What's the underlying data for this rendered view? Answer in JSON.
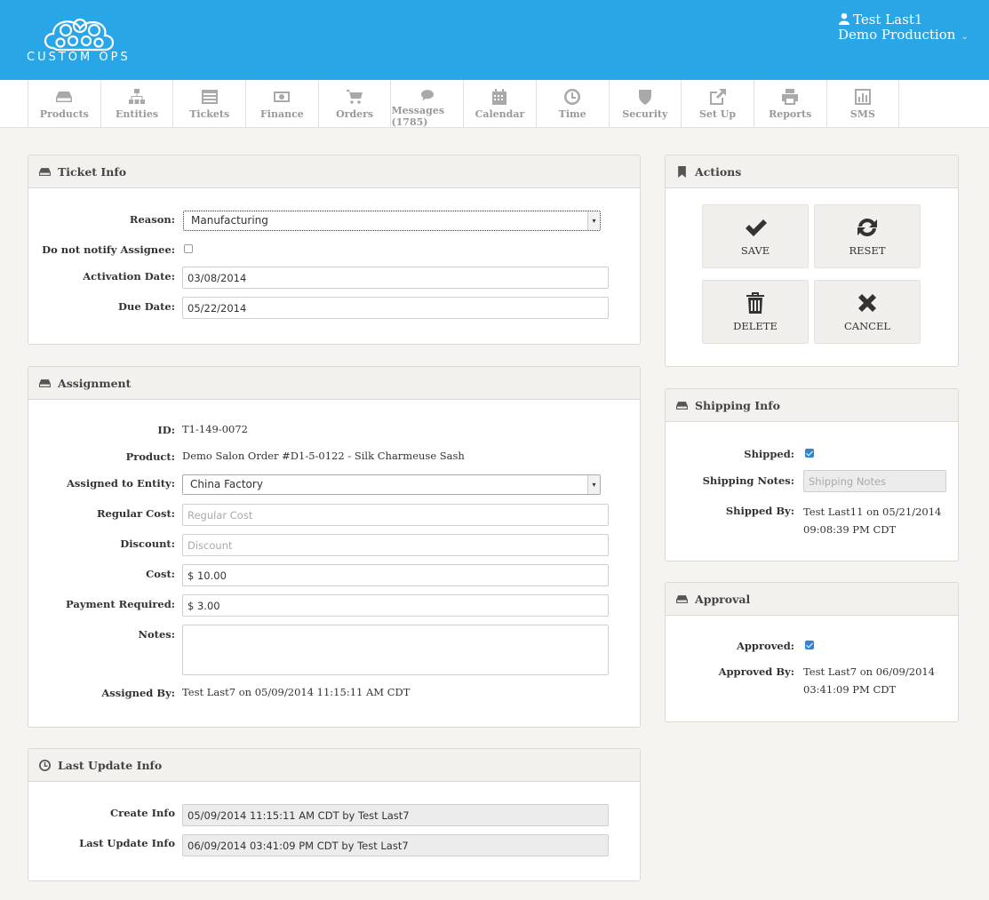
{
  "header": {
    "logo_text": "CUSTOM OPS",
    "user_name": "Test Last1",
    "company": "Demo Production"
  },
  "nav": [
    {
      "label": "Products",
      "icon": "drive-icon"
    },
    {
      "label": "Entities",
      "icon": "sitemap-icon"
    },
    {
      "label": "Tickets",
      "icon": "list-icon"
    },
    {
      "label": "Finance",
      "icon": "money-icon"
    },
    {
      "label": "Orders",
      "icon": "cart-icon"
    },
    {
      "label": "Messages (1785)",
      "icon": "comment-icon"
    },
    {
      "label": "Calendar",
      "icon": "calendar-icon"
    },
    {
      "label": "Time",
      "icon": "clock-icon"
    },
    {
      "label": "Security",
      "icon": "shield-icon"
    },
    {
      "label": "Set Up",
      "icon": "external-link-icon"
    },
    {
      "label": "Reports",
      "icon": "print-icon"
    },
    {
      "label": "SMS",
      "icon": "bar-chart-icon"
    }
  ],
  "ticket_info": {
    "title": "Ticket Info",
    "reason_label": "Reason:",
    "reason_value": "Manufacturing",
    "notify_label": "Do not notify Assignee:",
    "notify_checked": false,
    "activation_label": "Activation Date:",
    "activation_value": "03/08/2014",
    "due_label": "Due Date:",
    "due_value": "05/22/2014"
  },
  "assignment": {
    "title": "Assignment",
    "id_label": "ID:",
    "id_value": "T1-149-0072",
    "product_label": "Product:",
    "product_value": "Demo Salon Order #D1-5-0122 - Silk Charmeuse Sash",
    "entity_label": "Assigned to Entity:",
    "entity_value": "China Factory",
    "regular_cost_label": "Regular Cost:",
    "regular_cost_placeholder": "Regular Cost",
    "discount_label": "Discount:",
    "discount_placeholder": "Discount",
    "cost_label": "Cost:",
    "cost_value": "$ 10.00",
    "payment_label": "Payment Required:",
    "payment_value": "$ 3.00",
    "notes_label": "Notes:",
    "notes_value": "",
    "assigned_by_label": "Assigned By:",
    "assigned_by_value": "Test Last7 on 05/09/2014 11:15:11 AM CDT"
  },
  "last_update": {
    "title": "Last Update Info",
    "create_label": "Create Info",
    "create_value": "05/09/2014 11:15:11 AM CDT by Test Last7",
    "update_label": "Last Update Info",
    "update_value": "06/09/2014 03:41:09 PM CDT by Test Last7"
  },
  "actions": {
    "title": "Actions",
    "save": "SAVE",
    "reset": "RESET",
    "delete": "DELETE",
    "cancel": "CANCEL"
  },
  "shipping": {
    "title": "Shipping Info",
    "shipped_label": "Shipped:",
    "shipped_checked": true,
    "notes_label": "Shipping Notes:",
    "notes_placeholder": "Shipping Notes",
    "shipped_by_label": "Shipped By:",
    "shipped_by_line1": "Test Last11 on 05/21/2014",
    "shipped_by_line2": "09:08:39 PM CDT"
  },
  "approval": {
    "title": "Approval",
    "approved_label": "Approved:",
    "approved_checked": true,
    "approved_by_label": "Approved By:",
    "approved_by_line1": "Test Last7 on 06/09/2014",
    "approved_by_line2": "03:41:09 PM CDT"
  },
  "colors": {
    "header_bg": "#29a6e6",
    "checkbox_on": "#2f86d6"
  }
}
